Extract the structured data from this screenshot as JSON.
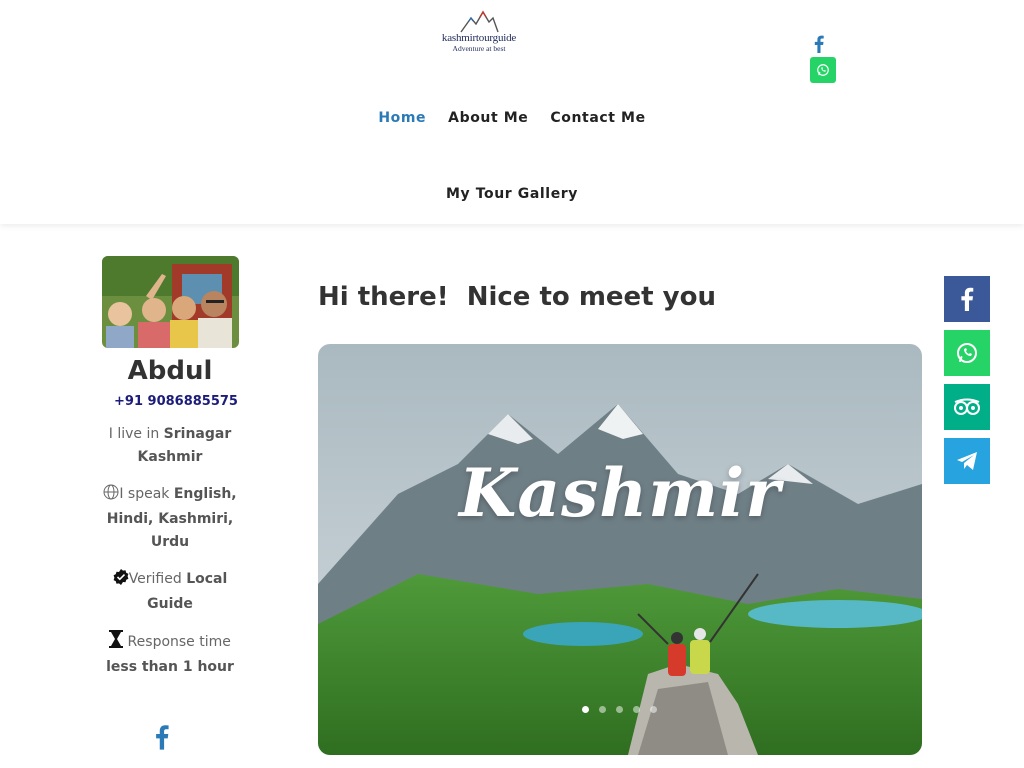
{
  "brand": {
    "name": "kashmirtourguide",
    "tagline": "Adventure at best"
  },
  "nav": {
    "items": [
      {
        "label": "Home",
        "active": true
      },
      {
        "label": "About Me",
        "active": false
      },
      {
        "label": "Contact Me",
        "active": false
      },
      {
        "label": "My Tour Gallery",
        "active": false
      }
    ]
  },
  "header_icons": [
    "facebook-icon",
    "whatsapp-icon"
  ],
  "profile": {
    "name": "Abdul",
    "phone": "+91 9086885575",
    "live_prefix": "I live in ",
    "live_value": "Srinagar Kashmir",
    "speak_prefix": "I speak ",
    "speak_value": "English, Hindi, Kashmiri, Urdu",
    "verified_prefix": "Verified  ",
    "verified_value": "Local Guide",
    "response_prefix": " Response time ",
    "response_value": "less than 1 hour"
  },
  "main": {
    "heading": "Hi there!  Nice to meet you",
    "hero_title": "Kashmir",
    "slides_total": 5,
    "slide_active": 1
  },
  "social_bar": [
    "facebook-icon",
    "whatsapp-icon",
    "tripadvisor-icon",
    "telegram-icon"
  ],
  "colors": {
    "accent": "#2b7ab8",
    "phone": "#1c1c7a",
    "facebook": "#3b5998",
    "whatsapp": "#25d366",
    "tripadvisor": "#00af87",
    "telegram": "#27a3e0"
  }
}
